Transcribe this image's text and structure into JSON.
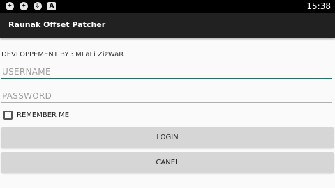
{
  "status_bar": {
    "icons": [
      "debug-icon",
      "debug-icon",
      "download-icon",
      "a-icon"
    ],
    "icon_glyphs": [
      "✦",
      "✦",
      "⇩",
      "A"
    ],
    "time": "15:38"
  },
  "app_bar": {
    "title": "Raunak Offset Patcher"
  },
  "form": {
    "developer_label": "DEVLOPPEMENT BY : MLaLi ZizWaR",
    "username_placeholder": "USERNAME",
    "password_placeholder": "PASSWORD",
    "remember_label": "REMEMBER ME",
    "remember_checked": false,
    "login_label": "LOGIN",
    "cancel_label": "CANEL"
  },
  "colors": {
    "app_bar": "#212121",
    "accent_underline": "#2a6e68",
    "button": "#d6d6d6"
  }
}
